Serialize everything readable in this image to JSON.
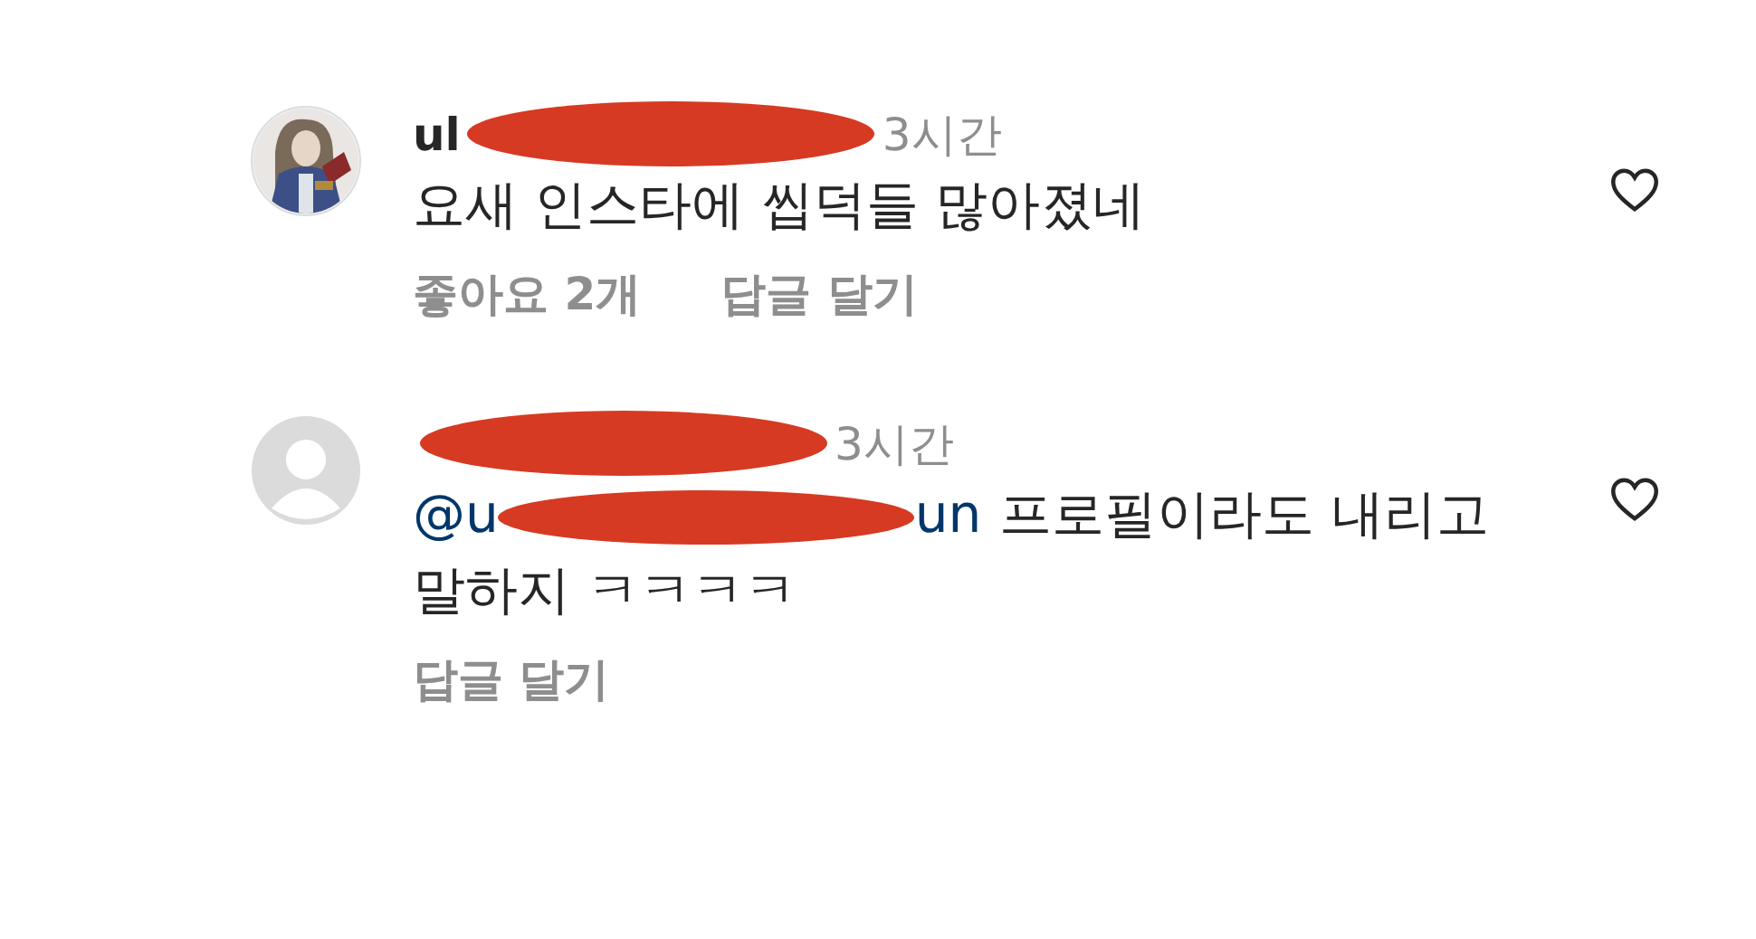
{
  "comments": [
    {
      "avatar": {
        "kind": "picture"
      },
      "username": "ul",
      "username_redacted": true,
      "time": "3시간",
      "text_lines": [
        "요새 인스타에 씹덕들 많아졌네"
      ],
      "likes": "좋아요 2개",
      "reply": "답글 달기",
      "liked": false
    },
    {
      "avatar": {
        "kind": "default"
      },
      "username_redacted": true,
      "time": "3시간",
      "mention_start": "@u",
      "mention_end": "un",
      "text_lines": [
        "프로필이라도 내리고",
        "말하지 ㅋㅋㅋㅋ"
      ],
      "reply": "답글 달기",
      "liked": false
    }
  ]
}
